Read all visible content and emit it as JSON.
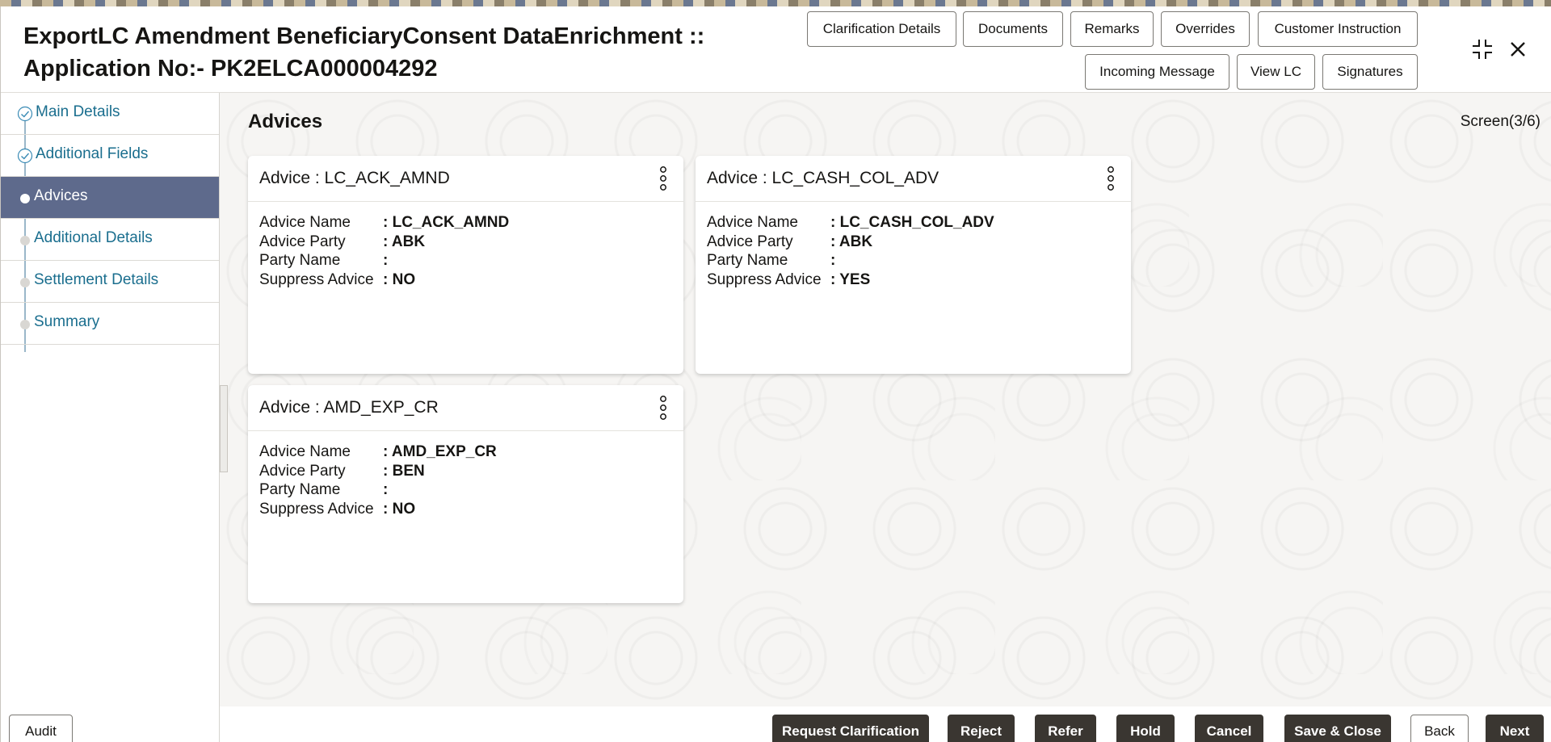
{
  "header": {
    "title_line1": "ExportLC Amendment BeneficiaryConsent DataEnrichment ::",
    "title_line2": "Application No:- PK2ELCA000004292",
    "buttons_row1": [
      "Clarification Details",
      "Documents",
      "Remarks",
      "Overrides",
      "Customer Instruction"
    ],
    "buttons_row2": [
      "Incoming Message",
      "View LC",
      "Signatures"
    ]
  },
  "sidebar": {
    "items": [
      {
        "label": "Main Details",
        "state": "done"
      },
      {
        "label": "Additional Fields",
        "state": "done"
      },
      {
        "label": "Advices",
        "state": "active"
      },
      {
        "label": "Additional Details",
        "state": "pending"
      },
      {
        "label": "Settlement Details",
        "state": "pending"
      },
      {
        "label": "Summary",
        "state": "pending"
      }
    ]
  },
  "main": {
    "section_title": "Advices",
    "screen_indicator": "Screen(3/6)",
    "field_labels": [
      "Advice Name",
      "Advice Party",
      "Party Name",
      "Suppress Advice"
    ],
    "cards": [
      {
        "title": "Advice : LC_ACK_AMND",
        "values": [
          ": LC_ACK_AMND",
          ": ABK",
          ":",
          ": NO"
        ]
      },
      {
        "title": "Advice : LC_CASH_COL_ADV",
        "values": [
          ": LC_CASH_COL_ADV",
          ": ABK",
          ":",
          ": YES"
        ]
      },
      {
        "title": "Advice : AMD_EXP_CR",
        "values": [
          ": AMD_EXP_CR",
          ": BEN",
          ":",
          ": NO"
        ]
      }
    ]
  },
  "footer": {
    "audit": "Audit",
    "request_clarification": "Request Clarification",
    "reject": "Reject",
    "refer": "Refer",
    "hold": "Hold",
    "cancel": "Cancel",
    "save_close": "Save & Close",
    "back": "Back",
    "next": "Next"
  },
  "colors": {
    "active_nav": "#5e6a8c",
    "nav_link": "#1a6e8e",
    "primary_button": "#3a3631"
  }
}
